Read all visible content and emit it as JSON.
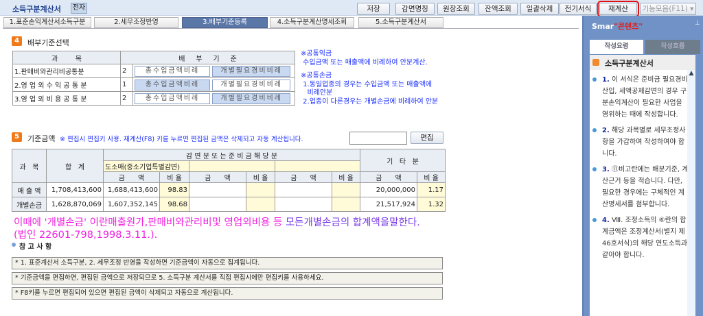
{
  "header": {
    "title": "소득구분계산서",
    "electronic_label": "전자"
  },
  "toolbar": [
    "저장",
    "감면명칭",
    "원장조회",
    "잔액조회",
    "일괄삭제",
    "전기서식",
    "재계산",
    "기능모음(F11) ▾"
  ],
  "tabs": [
    "1.표준손익계산서소득구분",
    "2.세무조정반영",
    "3.배부기준등록",
    "4.소득구분계산명세조회",
    "5.소득구분계산서"
  ],
  "section4": {
    "num": "4",
    "title": "배부기준선택",
    "headers": [
      "과        목",
      "배     부     기     준"
    ],
    "rows": [
      {
        "label": "1.판매비와관리비공통분",
        "value": "2",
        "opt1": "총수입금액비례",
        "opt2": "개별필요경비비례",
        "selected": 2
      },
      {
        "label": "2.영 업 외 수 익 공 통 분",
        "value": "1",
        "opt1": "총수입금액비례",
        "opt2": "개별필요경비비례",
        "selected": 1
      },
      {
        "label": "3.영 업 외 비 용 공 통 분",
        "value": "2",
        "opt1": "총수입금액비례",
        "opt2": "개별필요경비비례",
        "selected": 2
      }
    ],
    "notes": [
      "※공통익금",
      " 수입금액 또는 매출액에 비례하여 안분계산.",
      "※공통손금",
      " 1.동일업종의 경우는 수입금액 또는 매출액에",
      "   비례안분",
      " 2.업종이 다른경우는 개별손금에 비례하여 안분"
    ]
  },
  "section5": {
    "num": "5",
    "title": "기준금액",
    "notice": "※ 편집시 편집키 사용. 재계산(F8) 키를 누르면 편집된 금액은 삭제되고 자동 계산됩니다.",
    "edit_value": "",
    "edit_button": "편집",
    "headers": {
      "subject": "과   목",
      "total": "합   계",
      "reduction": "감 면 분 또 는 준 비 금 해 당 분",
      "reduction_type": "도소매(중소기업특별감면)",
      "other": "기   타   분",
      "amount": "금      액",
      "ratio": "비 율"
    },
    "rows": [
      {
        "label": "매 출 액",
        "total": "1,708,413,600",
        "amt1": "1,688,413,600",
        "ratio1": "98.83",
        "other_amt": "20,000,000",
        "other_ratio": "1.17"
      },
      {
        "label": "개별손금",
        "total": "1,628,870,069",
        "amt1": "1,607,352,145",
        "ratio1": "98.68",
        "other_amt": "21,517,924",
        "other_ratio": "1.32"
      }
    ]
  },
  "annotation": {
    "part1": "이때에 '개별손금' 이란매출원가,판매비와관리비및 영업외비용 등 ",
    "part2": "모든개별손금의 합계액을말한다.",
    "line2": "(법인 22601-798,1998.3.11.)."
  },
  "reference": {
    "title": "참 고 사 항",
    "items": [
      "* 1. 표준계산서 소득구분, 2. 세무조정 반영을 작성하면 기준금액이 자동으로 집계됩니다.",
      "* 기준금액을 편집하면, 편집된 금액으로 저장되므로 5. 소득구분 계산서를 직접 편집시에만 편집키를 사용하세요.",
      "* F8키를 누르면 편집되어 있으면 편집된 금액이 삭제되고 자동으로 계산됩니다."
    ]
  },
  "panel": {
    "header": "Smar",
    "overlay": "\"콘텐츠\"",
    "tabs": [
      "작성요령",
      "작성흐름"
    ],
    "title": "소득구분계산서",
    "items": [
      {
        "n": "1.",
        "t": "이 서식은 준비금 필요경비산입, 세액공제감면의 경우 구분손익계산이 필요한 사업을 영위하는 때에 작성합니다."
      },
      {
        "n": "2.",
        "t": "해당 과목별로 세무조정사항을 가감하여 작성하여야 합니다."
      },
      {
        "n": "3.",
        "t": "⑪비고란에는 배분기준, 계산근거 등을 적습니다. 다만, 필요한 경우에는 구체적인 계산명세서를 첨부합니다."
      },
      {
        "n": "4.",
        "t": "Ⅷ. 조정소득의 ⑥란의 합계금액은 조정계산서(별지 제46호서식)의 해당 연도소득과 같아야 합니다."
      }
    ]
  }
}
